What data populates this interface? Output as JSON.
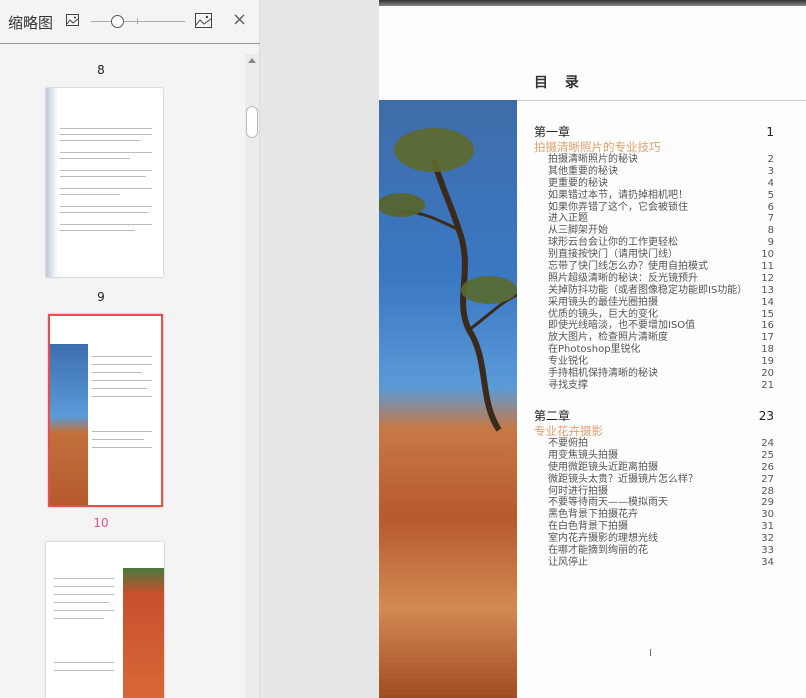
{
  "sidebar": {
    "title": "缩略图",
    "close": "×",
    "pages": [
      {
        "label": "8"
      },
      {
        "label": "9"
      },
      {
        "label": "10"
      }
    ]
  },
  "colors": {
    "accent": "#e84e4e",
    "subtitle": "#e0a070"
  },
  "page": {
    "title": "目 录",
    "footer": "I",
    "chapters": [
      {
        "name": "第一章",
        "page": "1",
        "subtitle": "拍摄清晰照片的专业技巧",
        "items": [
          {
            "t": "拍摄清晰照片的秘诀",
            "p": "2"
          },
          {
            "t": "其他重要的秘诀",
            "p": "3"
          },
          {
            "t": "更重要的秘诀",
            "p": "4"
          },
          {
            "t": "如果错过本节，请扔掉相机吧！",
            "p": "5"
          },
          {
            "t": "如果你弄错了这个，它会被锁住",
            "p": "6"
          },
          {
            "t": "进入正题",
            "p": "7"
          },
          {
            "t": "从三脚架开始",
            "p": "8"
          },
          {
            "t": "球形云台会让你的工作更轻松",
            "p": "9"
          },
          {
            "t": "别直接按快门（请用快门线）",
            "p": "10"
          },
          {
            "t": "忘带了快门线怎么办？使用自拍模式",
            "p": "11"
          },
          {
            "t": "照片超级清晰的秘诀：反光镜预升",
            "p": "12"
          },
          {
            "t": "关掉防抖功能（或者图像稳定功能即IS功能）",
            "p": "13"
          },
          {
            "t": "采用镜头的最佳光圈拍摄",
            "p": "14"
          },
          {
            "t": "优质的镜头，巨大的变化",
            "p": "15"
          },
          {
            "t": "即使光线暗淡，也不要增加ISO值",
            "p": "16"
          },
          {
            "t": "放大图片，检查照片清晰度",
            "p": "17"
          },
          {
            "t": "在Photoshop里锐化",
            "p": "18"
          },
          {
            "t": "专业锐化",
            "p": "19"
          },
          {
            "t": "手持相机保持清晰的秘诀",
            "p": "20"
          },
          {
            "t": "寻找支撑",
            "p": "21"
          }
        ]
      },
      {
        "name": "第二章",
        "page": "23",
        "subtitle": "专业花卉摄影",
        "items": [
          {
            "t": "不要俯拍",
            "p": "24"
          },
          {
            "t": "用变焦镜头拍摄",
            "p": "25"
          },
          {
            "t": "使用微距镜头近距离拍摄",
            "p": "26"
          },
          {
            "t": "微距镜头太贵？近摄镜片怎么样？",
            "p": "27"
          },
          {
            "t": "何时进行拍摄",
            "p": "28"
          },
          {
            "t": "不要等待雨天——模拟雨天",
            "p": "29"
          },
          {
            "t": "黑色背景下拍摄花卉",
            "p": "30"
          },
          {
            "t": "在白色背景下拍摄",
            "p": "31"
          },
          {
            "t": "室内花卉摄影的理想光线",
            "p": "32"
          },
          {
            "t": "在哪才能摘到绚丽的花",
            "p": "33"
          },
          {
            "t": "让风停止",
            "p": "34"
          }
        ]
      }
    ]
  }
}
